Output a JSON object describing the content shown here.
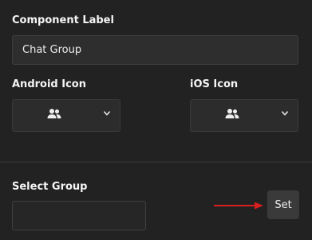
{
  "component_label": {
    "label": "Component Label",
    "value": "Chat Group"
  },
  "android_icon": {
    "label": "Android Icon",
    "selected_icon": "people-icon"
  },
  "ios_icon": {
    "label": "iOS Icon",
    "selected_icon": "people-icon"
  },
  "select_group": {
    "label": "Select Group",
    "value": ""
  },
  "set_button": {
    "label": "Set"
  },
  "colors": {
    "background": "#222222",
    "arrow": "#d81f1f"
  }
}
